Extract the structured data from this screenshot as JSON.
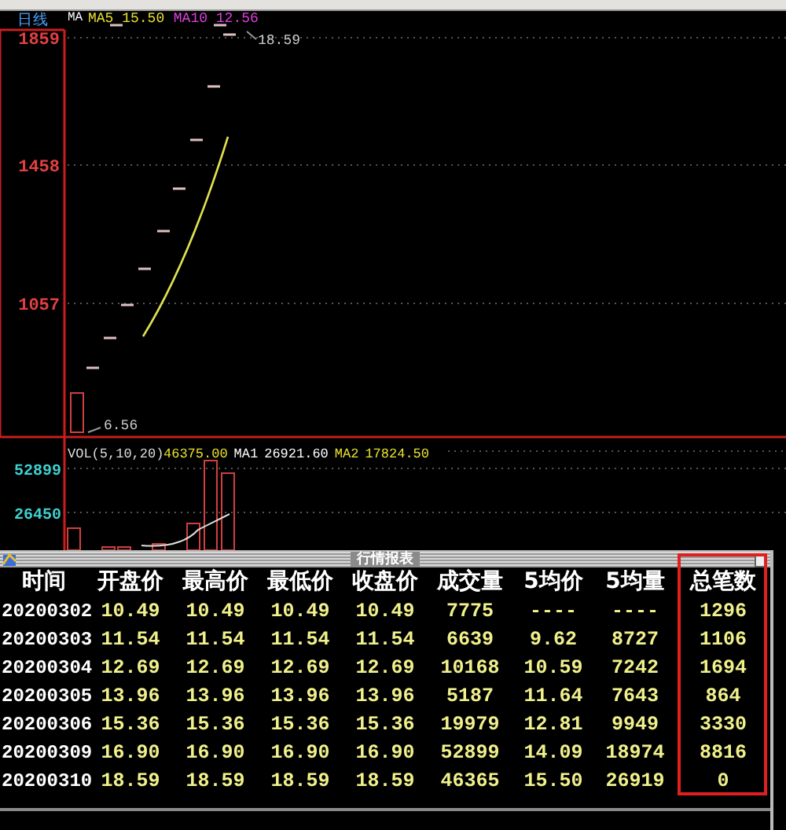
{
  "chart": {
    "period": "日线",
    "ma_label": "MA",
    "ma_values": [
      {
        "text": "MA5 15.50",
        "color": "#e8e030"
      },
      {
        "text": "MA10 12.56",
        "color": "#e040e0"
      }
    ],
    "price_ticks": [
      "1859",
      "1458",
      "1057"
    ],
    "high_note": "18.59",
    "low_note": "6.56"
  },
  "volume": {
    "title": "VOL(5,10,20)",
    "values": [
      {
        "text": "46375.00",
        "color": "#e8e030"
      },
      {
        "text": "MA1",
        "color": "#ffffff"
      },
      {
        "text": "26921.60",
        "color": "#ffffff"
      },
      {
        "text": "MA2",
        "color": "#e8e030"
      },
      {
        "text": "17824.50",
        "color": "#e8e030"
      }
    ],
    "ticks": [
      "52899",
      "26450"
    ]
  },
  "report": {
    "title": "行情报表",
    "columns": [
      {
        "label": "时间",
        "highlighted": false
      },
      {
        "label": "开盘价",
        "highlighted": false
      },
      {
        "label": "最高价",
        "highlighted": false
      },
      {
        "label": "最低价",
        "highlighted": false
      },
      {
        "label": "收盘价",
        "highlighted": false
      },
      {
        "label": "成交量",
        "highlighted": false
      },
      {
        "label": "5均价",
        "highlighted": false
      },
      {
        "label": "5均量",
        "highlighted": false
      },
      {
        "label": "总笔数",
        "highlighted": true
      }
    ],
    "rows": [
      [
        "20200302",
        "10.49",
        "10.49",
        "10.49",
        "10.49",
        "7775",
        "----",
        "----",
        "1296"
      ],
      [
        "20200303",
        "11.54",
        "11.54",
        "11.54",
        "11.54",
        "6639",
        "9.62",
        "8727",
        "1106"
      ],
      [
        "20200304",
        "12.69",
        "12.69",
        "12.69",
        "12.69",
        "10168",
        "10.59",
        "7242",
        "1694"
      ],
      [
        "20200305",
        "13.96",
        "13.96",
        "13.96",
        "13.96",
        "5187",
        "11.64",
        "7643",
        "864"
      ],
      [
        "20200306",
        "15.36",
        "15.36",
        "15.36",
        "15.36",
        "19979",
        "12.81",
        "9949",
        "3330"
      ],
      [
        "20200309",
        "16.90",
        "16.90",
        "16.90",
        "16.90",
        "52899",
        "14.09",
        "18974",
        "8816"
      ],
      [
        "20200310",
        "18.59",
        "18.59",
        "18.59",
        "18.59",
        "46365",
        "15.50",
        "26919",
        "0"
      ]
    ]
  }
}
